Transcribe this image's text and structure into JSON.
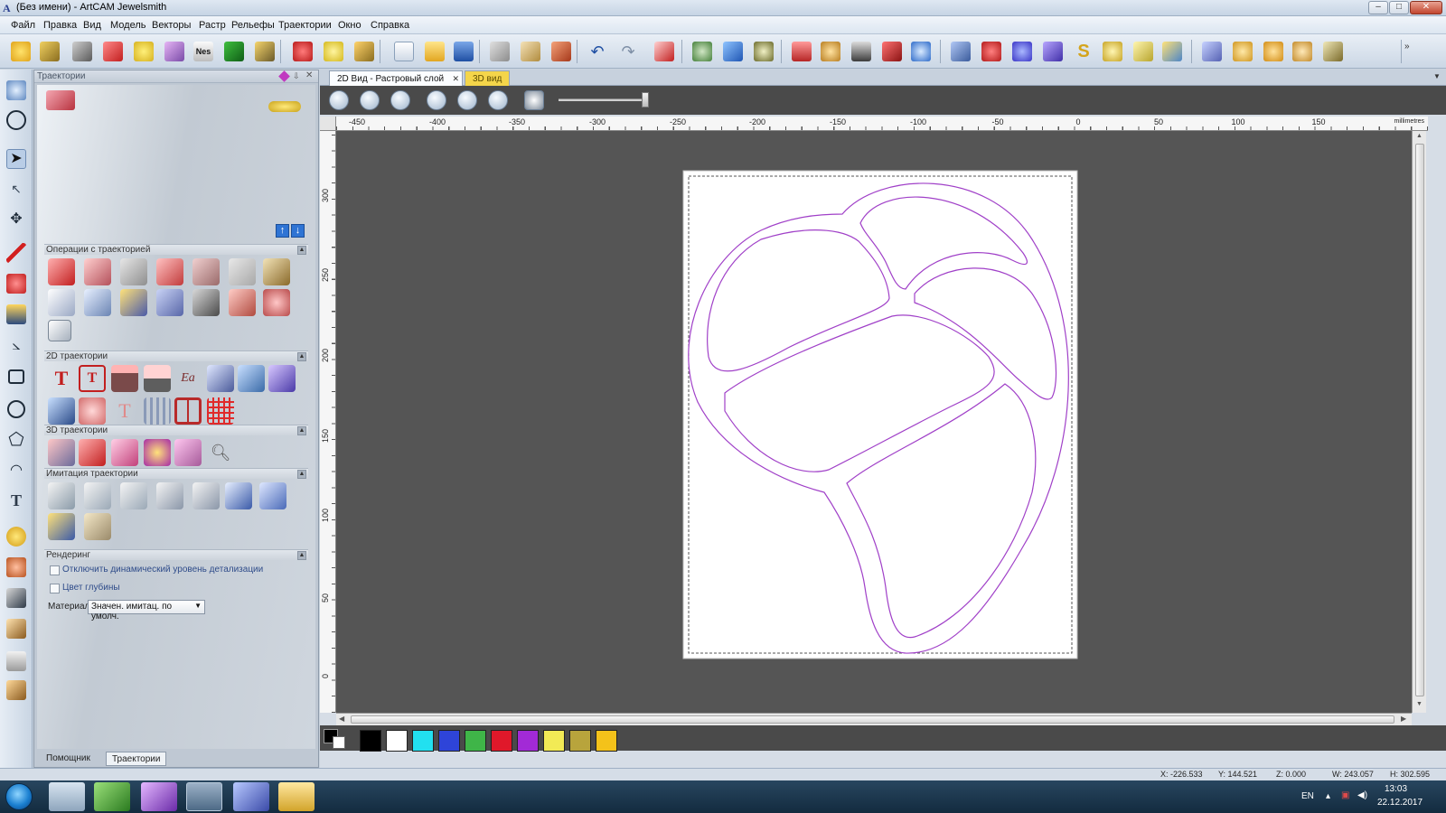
{
  "window": {
    "title": "(Без имени) - ArtCAM Jewelsmith",
    "buttons": {
      "minimize": "–",
      "maximize": "□",
      "close": "✕"
    }
  },
  "menu": [
    "Файл",
    "Правка",
    "Вид",
    "Модель",
    "Векторы",
    "Растр",
    "Рельефы",
    "Траектории",
    "Окно",
    "Справка"
  ],
  "panel": {
    "title": "Траектории",
    "sections": {
      "ops": "Операции с траекторией",
      "t2d": "2D траектории",
      "t3d": "3D траектории",
      "sim": "Имитация траектории",
      "render": "Рендеринг"
    },
    "render": {
      "cb1": "Отключить динамический уровень детализации",
      "cb2": "Цвет глубины",
      "material_label": "Материал",
      "material_value": "Значен. имитац. по умолч."
    },
    "tabs": {
      "helper": "Помощник",
      "trajectories": "Траектории"
    }
  },
  "doc": {
    "tab_2d": "2D Вид - Растровый слой",
    "tab_3d": "3D вид",
    "ruler_h": [
      "-450",
      "-400",
      "-350",
      "-300",
      "-250",
      "-200",
      "-150",
      "-100",
      "-50",
      "0",
      "50",
      "100",
      "150"
    ],
    "ruler_v": [
      "300",
      "250",
      "200",
      "150",
      "100",
      "50",
      "0"
    ],
    "units": "millimetres"
  },
  "palette": {
    "colors": [
      "#000000",
      "#ffffff",
      "#22e0f0",
      "#2e44d9",
      "#3fb548",
      "#e0182a",
      "#a22ad6",
      "#f2ea55",
      "#b8a43c",
      "#f4c21a"
    ]
  },
  "status": {
    "x": "X: -226.533",
    "y": "Y: 144.521",
    "z": "Z: 0.000",
    "w": "W: 243.057",
    "h": "H: 302.595"
  },
  "taskbar": {
    "lang": "EN",
    "time": "13:03",
    "date": "22.12.2017"
  },
  "colors": {
    "vector": "#a040c8",
    "canvas": "#555555",
    "accent": "#f4d54a"
  }
}
